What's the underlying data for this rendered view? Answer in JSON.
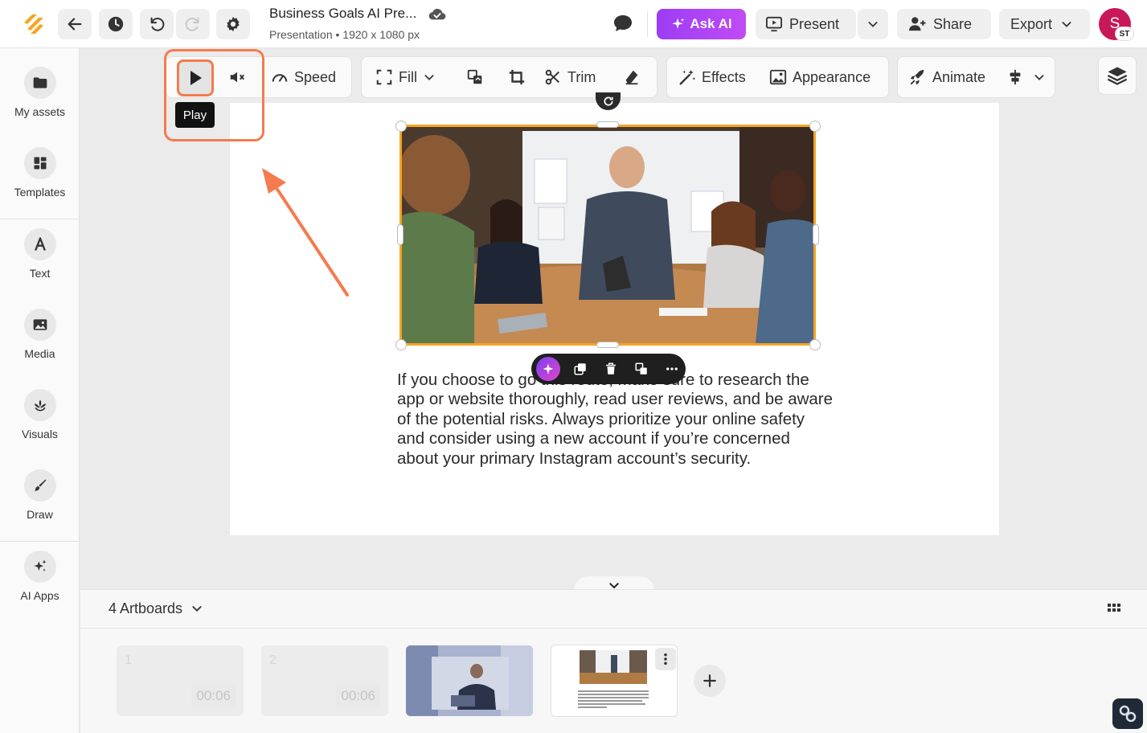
{
  "header": {
    "doc_title": "Business Goals AI Pre...",
    "doc_subtitle": "Presentation • 1920 x 1080 px",
    "ask_ai_label": "Ask AI",
    "present_label": "Present",
    "share_label": "Share",
    "export_label": "Export",
    "avatar_initial": "S",
    "avatar_badge": "ST"
  },
  "sidebar": {
    "items": [
      {
        "label": "My assets",
        "icon": "folder-icon"
      },
      {
        "label": "Templates",
        "icon": "templates-icon"
      },
      {
        "label": "Text",
        "icon": "text-icon"
      },
      {
        "label": "Media",
        "icon": "image-icon"
      },
      {
        "label": "Visuals",
        "icon": "visuals-icon"
      },
      {
        "label": "Draw",
        "icon": "brush-icon"
      },
      {
        "label": "AI Apps",
        "icon": "sparkle-icon"
      }
    ]
  },
  "toolbar": {
    "play_tooltip": "Play",
    "speed_label": "Speed",
    "fill_label": "Fill",
    "trim_label": "Trim",
    "effects_label": "Effects",
    "appearance_label": "Appearance",
    "animate_label": "Animate"
  },
  "canvas": {
    "body_text": "If you choose to go this route, make sure to research the app or website thoroughly, read user reviews, and be aware of the potential risks. Always prioritize your online safety and consider using a new account if you’re concerned about your primary Instagram account’s security."
  },
  "bottom": {
    "artboards_label": "4 Artboards",
    "thumbs": [
      {
        "num": "1",
        "time": "00:06"
      },
      {
        "num": "2",
        "time": "00:06"
      }
    ]
  },
  "colors": {
    "accent_orange": "#f47b4f",
    "selection_orange": "#f5a623",
    "ask_ai_purple": "#9b3df5",
    "avatar_pink": "#c8185a"
  }
}
